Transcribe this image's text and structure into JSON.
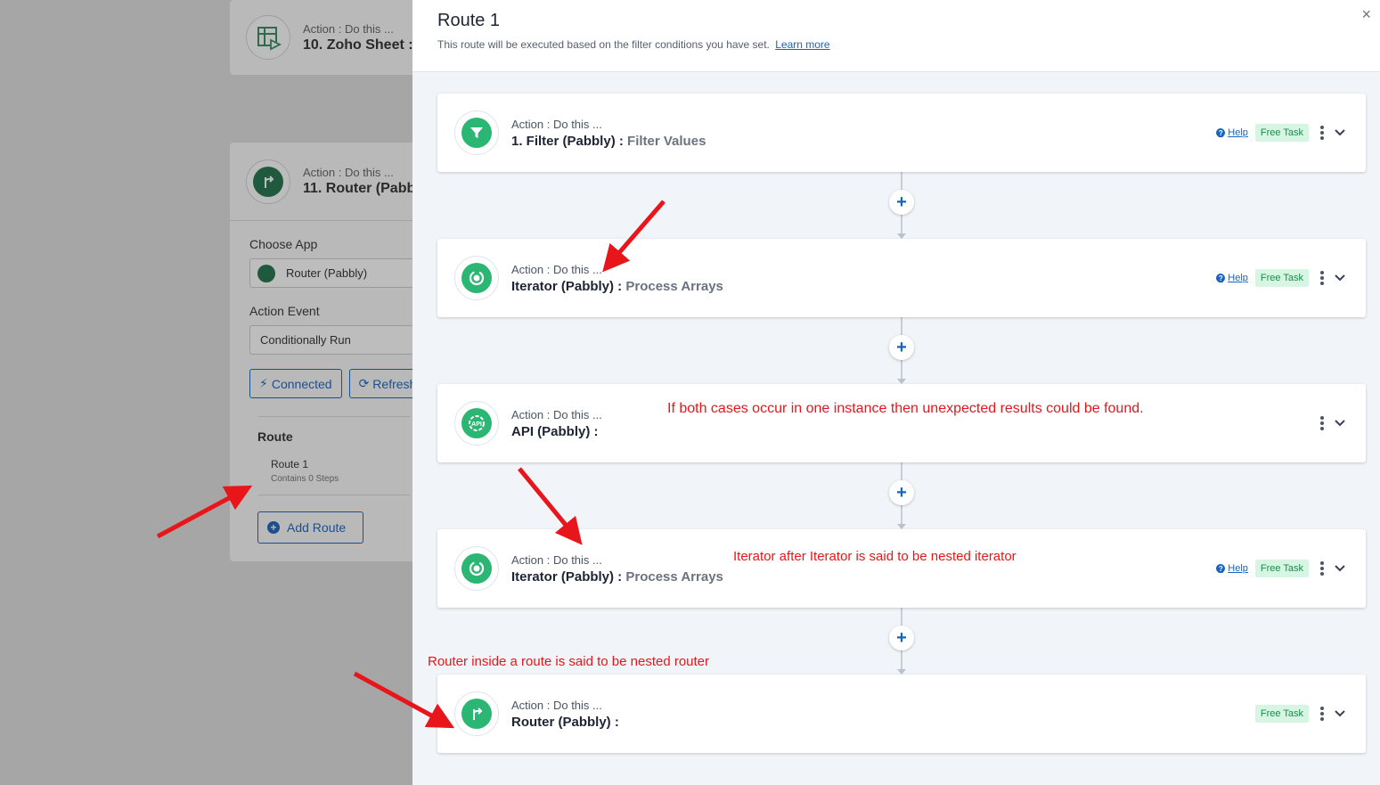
{
  "background": {
    "card1": {
      "action_label": "Action : Do this ...",
      "title": "10. Zoho Sheet :"
    },
    "card2": {
      "action_label": "Action : Do this ...",
      "title": "11. Router (Pabb",
      "choose_app_label": "Choose App",
      "choose_app_value": "Router (Pabbly)",
      "action_event_label": "Action Event",
      "action_event_value": "Conditionally Run",
      "connected_label": "Connected",
      "refresh_label": "Refresh",
      "route_label": "Route",
      "route_item_name": "Route 1",
      "route_item_sub": "Contains 0 Steps",
      "add_route_label": "Add Route"
    }
  },
  "modal": {
    "title": "Route 1",
    "subtitle": "This route will be executed based on the filter conditions you have set.",
    "learn_more": "Learn more",
    "close": "×"
  },
  "steps": [
    {
      "action_label": "Action : Do this ...",
      "title": "1. Filter (Pabbly) :",
      "event": "Filter Values",
      "help": "Help",
      "badge": "Free Task",
      "icon": "filter-icon"
    },
    {
      "action_label": "Action : Do this ...",
      "title": "Iterator (Pabbly) :",
      "event": "Process Arrays",
      "help": "Help",
      "badge": "Free Task",
      "icon": "iterator-icon"
    },
    {
      "action_label": "Action : Do this ...",
      "title": "API (Pabbly) :",
      "event": "",
      "help": "",
      "badge": "",
      "icon": "api-icon"
    },
    {
      "action_label": "Action : Do this ...",
      "title": "Iterator (Pabbly) :",
      "event": "Process Arrays",
      "help": "Help",
      "badge": "Free Task",
      "icon": "iterator-icon"
    },
    {
      "action_label": "Action : Do this ...",
      "title": "Router (Pabbly) :",
      "event": "",
      "help": "",
      "badge": "Free Task",
      "icon": "router-icon"
    }
  ],
  "annotations": {
    "api_note": "If both cases occur in one instance then unexpected results could be found.",
    "iterator_note": "Iterator after Iterator is said to be nested iterator",
    "router_note": "Router inside a route is said to be nested router"
  },
  "colors": {
    "accent": "#1565c0",
    "app_green": "#2bb673",
    "annotation_red": "#e8161b",
    "badge_bg": "#d7f5e3"
  }
}
